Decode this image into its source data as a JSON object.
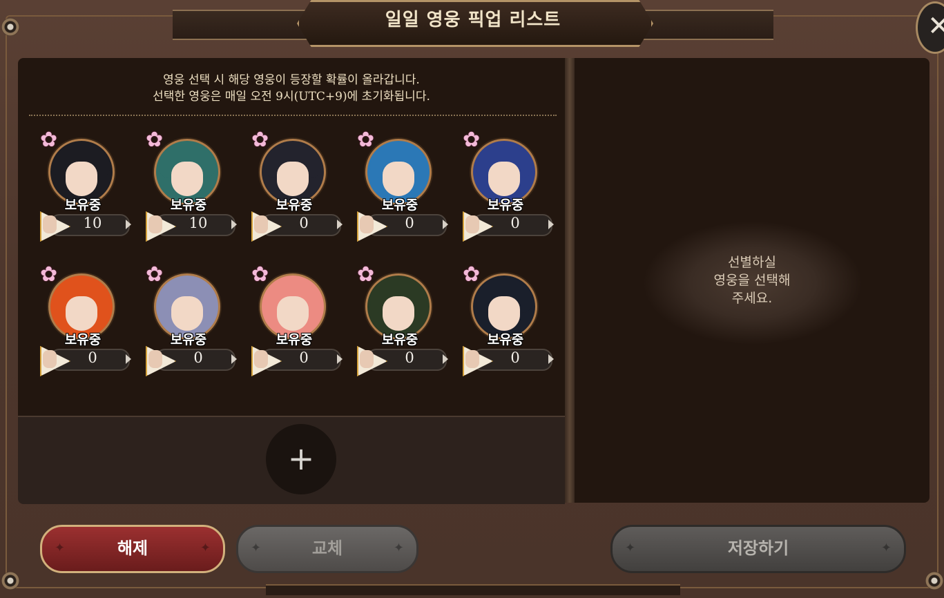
{
  "title": "일일 영웅 픽업 리스트",
  "close_icon": "close-x-icon",
  "info": {
    "line1": "영웅 선택 시 해당 영웅이 등장할 확률이 올라갑니다.",
    "line2": "선택한 영웅은 매일 오전 9시(UTC+9)에 초기화됩니다."
  },
  "heroes": [
    {
      "status": "보유중",
      "count": "10",
      "hair": "#1c1c22"
    },
    {
      "status": "보유중",
      "count": "10",
      "hair": "#2f6f69"
    },
    {
      "status": "보유중",
      "count": "0",
      "hair": "#23232d"
    },
    {
      "status": "보유중",
      "count": "0",
      "hair": "#2b78b6"
    },
    {
      "status": "보유중",
      "count": "0",
      "hair": "#2c3f8c"
    },
    {
      "status": "보유중",
      "count": "0",
      "hair": "#e0521c"
    },
    {
      "status": "보유중",
      "count": "0",
      "hair": "#8c8fb5"
    },
    {
      "status": "보유중",
      "count": "0",
      "hair": "#ec8b82"
    },
    {
      "status": "보유중",
      "count": "0",
      "hair": "#2b3a24"
    },
    {
      "status": "보유중",
      "count": "0",
      "hair": "#1a1f2b"
    }
  ],
  "add_label": "+",
  "guide": {
    "line1": "선별하실",
    "line2": "영웅을 선택해",
    "line3": "주세요."
  },
  "buttons": {
    "release": "해제",
    "swap": "교체",
    "save": "저장하기"
  }
}
